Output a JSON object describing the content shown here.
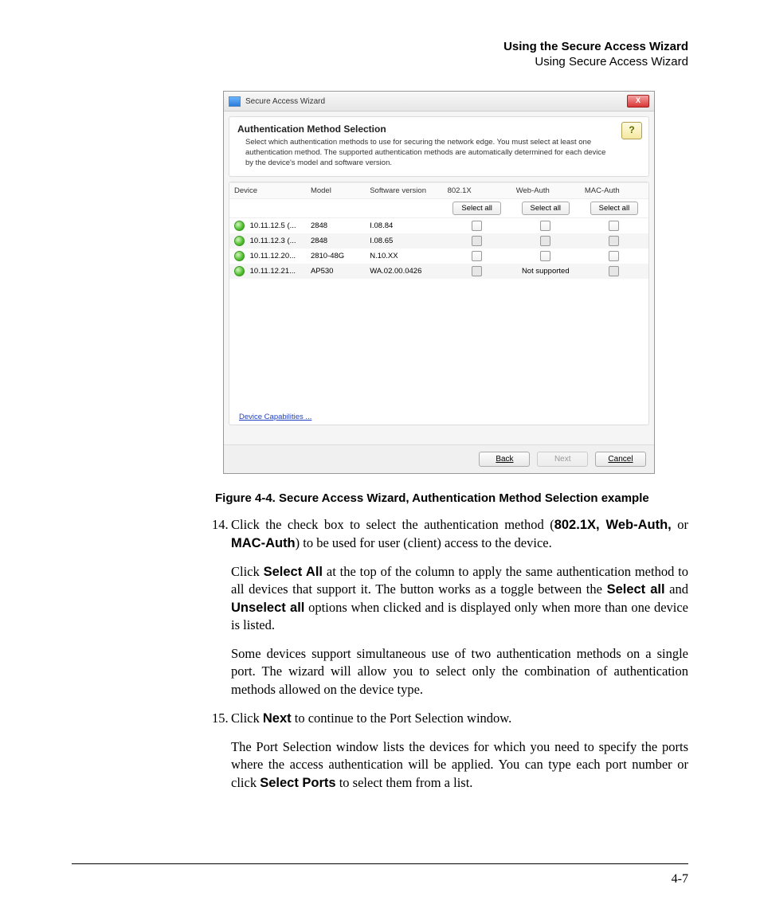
{
  "header": {
    "bold": "Using the Secure Access Wizard",
    "light": "Using Secure Access Wizard"
  },
  "window": {
    "title": "Secure Access Wizard",
    "close_label": "X",
    "help_label": "?",
    "section_title": "Authentication Method Selection",
    "section_desc": "Select which authentication methods to use for securing the network edge. You must select at least one authentication method. The supported authentication methods are automatically determined for each device by the device's model and software version.",
    "columns": {
      "device": "Device",
      "model": "Model",
      "swver": "Software version",
      "dot1x": "802.1X",
      "webauth": "Web-Auth",
      "macauth": "MAC-Auth"
    },
    "select_all": "Select all",
    "rows": [
      {
        "device": "10.11.12.5 (...",
        "model": "2848",
        "swver": "I.08.84",
        "dot1x": "cb",
        "webauth": "cb",
        "macauth": "cb",
        "shaded": false
      },
      {
        "device": "10.11.12.3 (...",
        "model": "2848",
        "swver": "I.08.65",
        "dot1x": "cb",
        "webauth": "cb",
        "macauth": "cb",
        "shaded": true
      },
      {
        "device": "10.11.12.20...",
        "model": "2810-48G",
        "swver": "N.10.XX",
        "dot1x": "cb",
        "webauth": "cb",
        "macauth": "cb",
        "shaded": false
      },
      {
        "device": "10.11.12.21...",
        "model": "AP530",
        "swver": "WA.02.00.0426",
        "dot1x": "cb",
        "webauth": "Not supported",
        "macauth": "cb",
        "shaded": true
      }
    ],
    "link": "Device Capabilities ...",
    "buttons": {
      "back": "Back",
      "next": "Next",
      "cancel": "Cancel"
    }
  },
  "caption": "Figure 4-4. Secure Access Wizard, Authentication Method Selection example",
  "steps": {
    "s14": {
      "num": "14.",
      "p1a": "Click the check box to select the authentication method (",
      "p1b": "802.1X, Web-Auth,",
      "p1c": " or ",
      "p1d": "MAC-Auth",
      "p1e": ") to be used for user (client) access to the device.",
      "p2a": "Click ",
      "p2b": "Select All",
      "p2c": " at the top of the column to apply the same authentication method to all devices that support it. The button works as a toggle between the ",
      "p2d": "Select all",
      "p2e": " and ",
      "p2f": "Unselect all",
      "p2g": " options when clicked and is displayed only when more than one device is listed.",
      "p3": "Some devices support simultaneous use of two authentication methods on a single port. The wizard will allow you to select only the combination of authentication methods allowed on the device type."
    },
    "s15": {
      "num": "15.",
      "p1a": "Click ",
      "p1b": "Next",
      "p1c": " to continue to the Port Selection window.",
      "p2a": "The Port Selection window lists the devices for which you need to specify the ports where the access authentication will be applied. You can type each port number or click ",
      "p2b": "Select Ports",
      "p2c": " to select them from a list."
    }
  },
  "page_number": "4-7"
}
